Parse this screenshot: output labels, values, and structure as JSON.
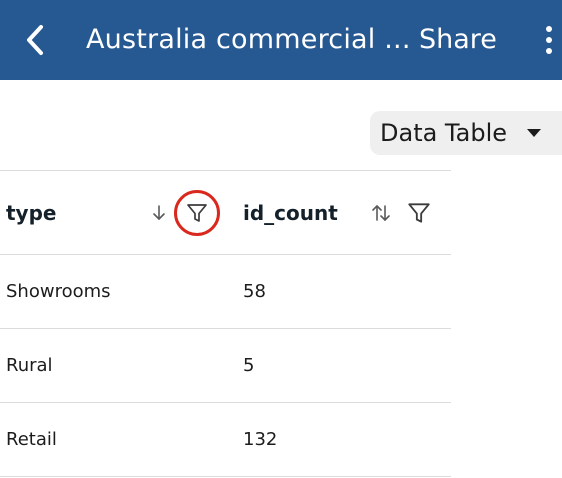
{
  "app_bar": {
    "title": "Australia commercial ...",
    "share_label": "Share",
    "icons": [
      "back-arrow-icon",
      "more-vert-icon"
    ],
    "background": "#265891"
  },
  "view_selector": {
    "selected": "Data Table"
  },
  "table": {
    "columns": [
      {
        "label": "type",
        "sort_icon": "sort-descending-icon",
        "filter_icon": "filter-icon",
        "highlighted": true
      },
      {
        "label": "id_count",
        "sort_icon": "sort-both-icon",
        "filter_icon": "filter-icon",
        "highlighted": false
      }
    ],
    "rows": [
      {
        "type": "Showrooms",
        "id_count": "58"
      },
      {
        "type": "Rural",
        "id_count": "5"
      },
      {
        "type": "Retail",
        "id_count": "132"
      }
    ]
  },
  "colors": {
    "highlight_ring": "#d9281e",
    "divider": "#dcdcdc",
    "selector_bg": "#efefef"
  }
}
